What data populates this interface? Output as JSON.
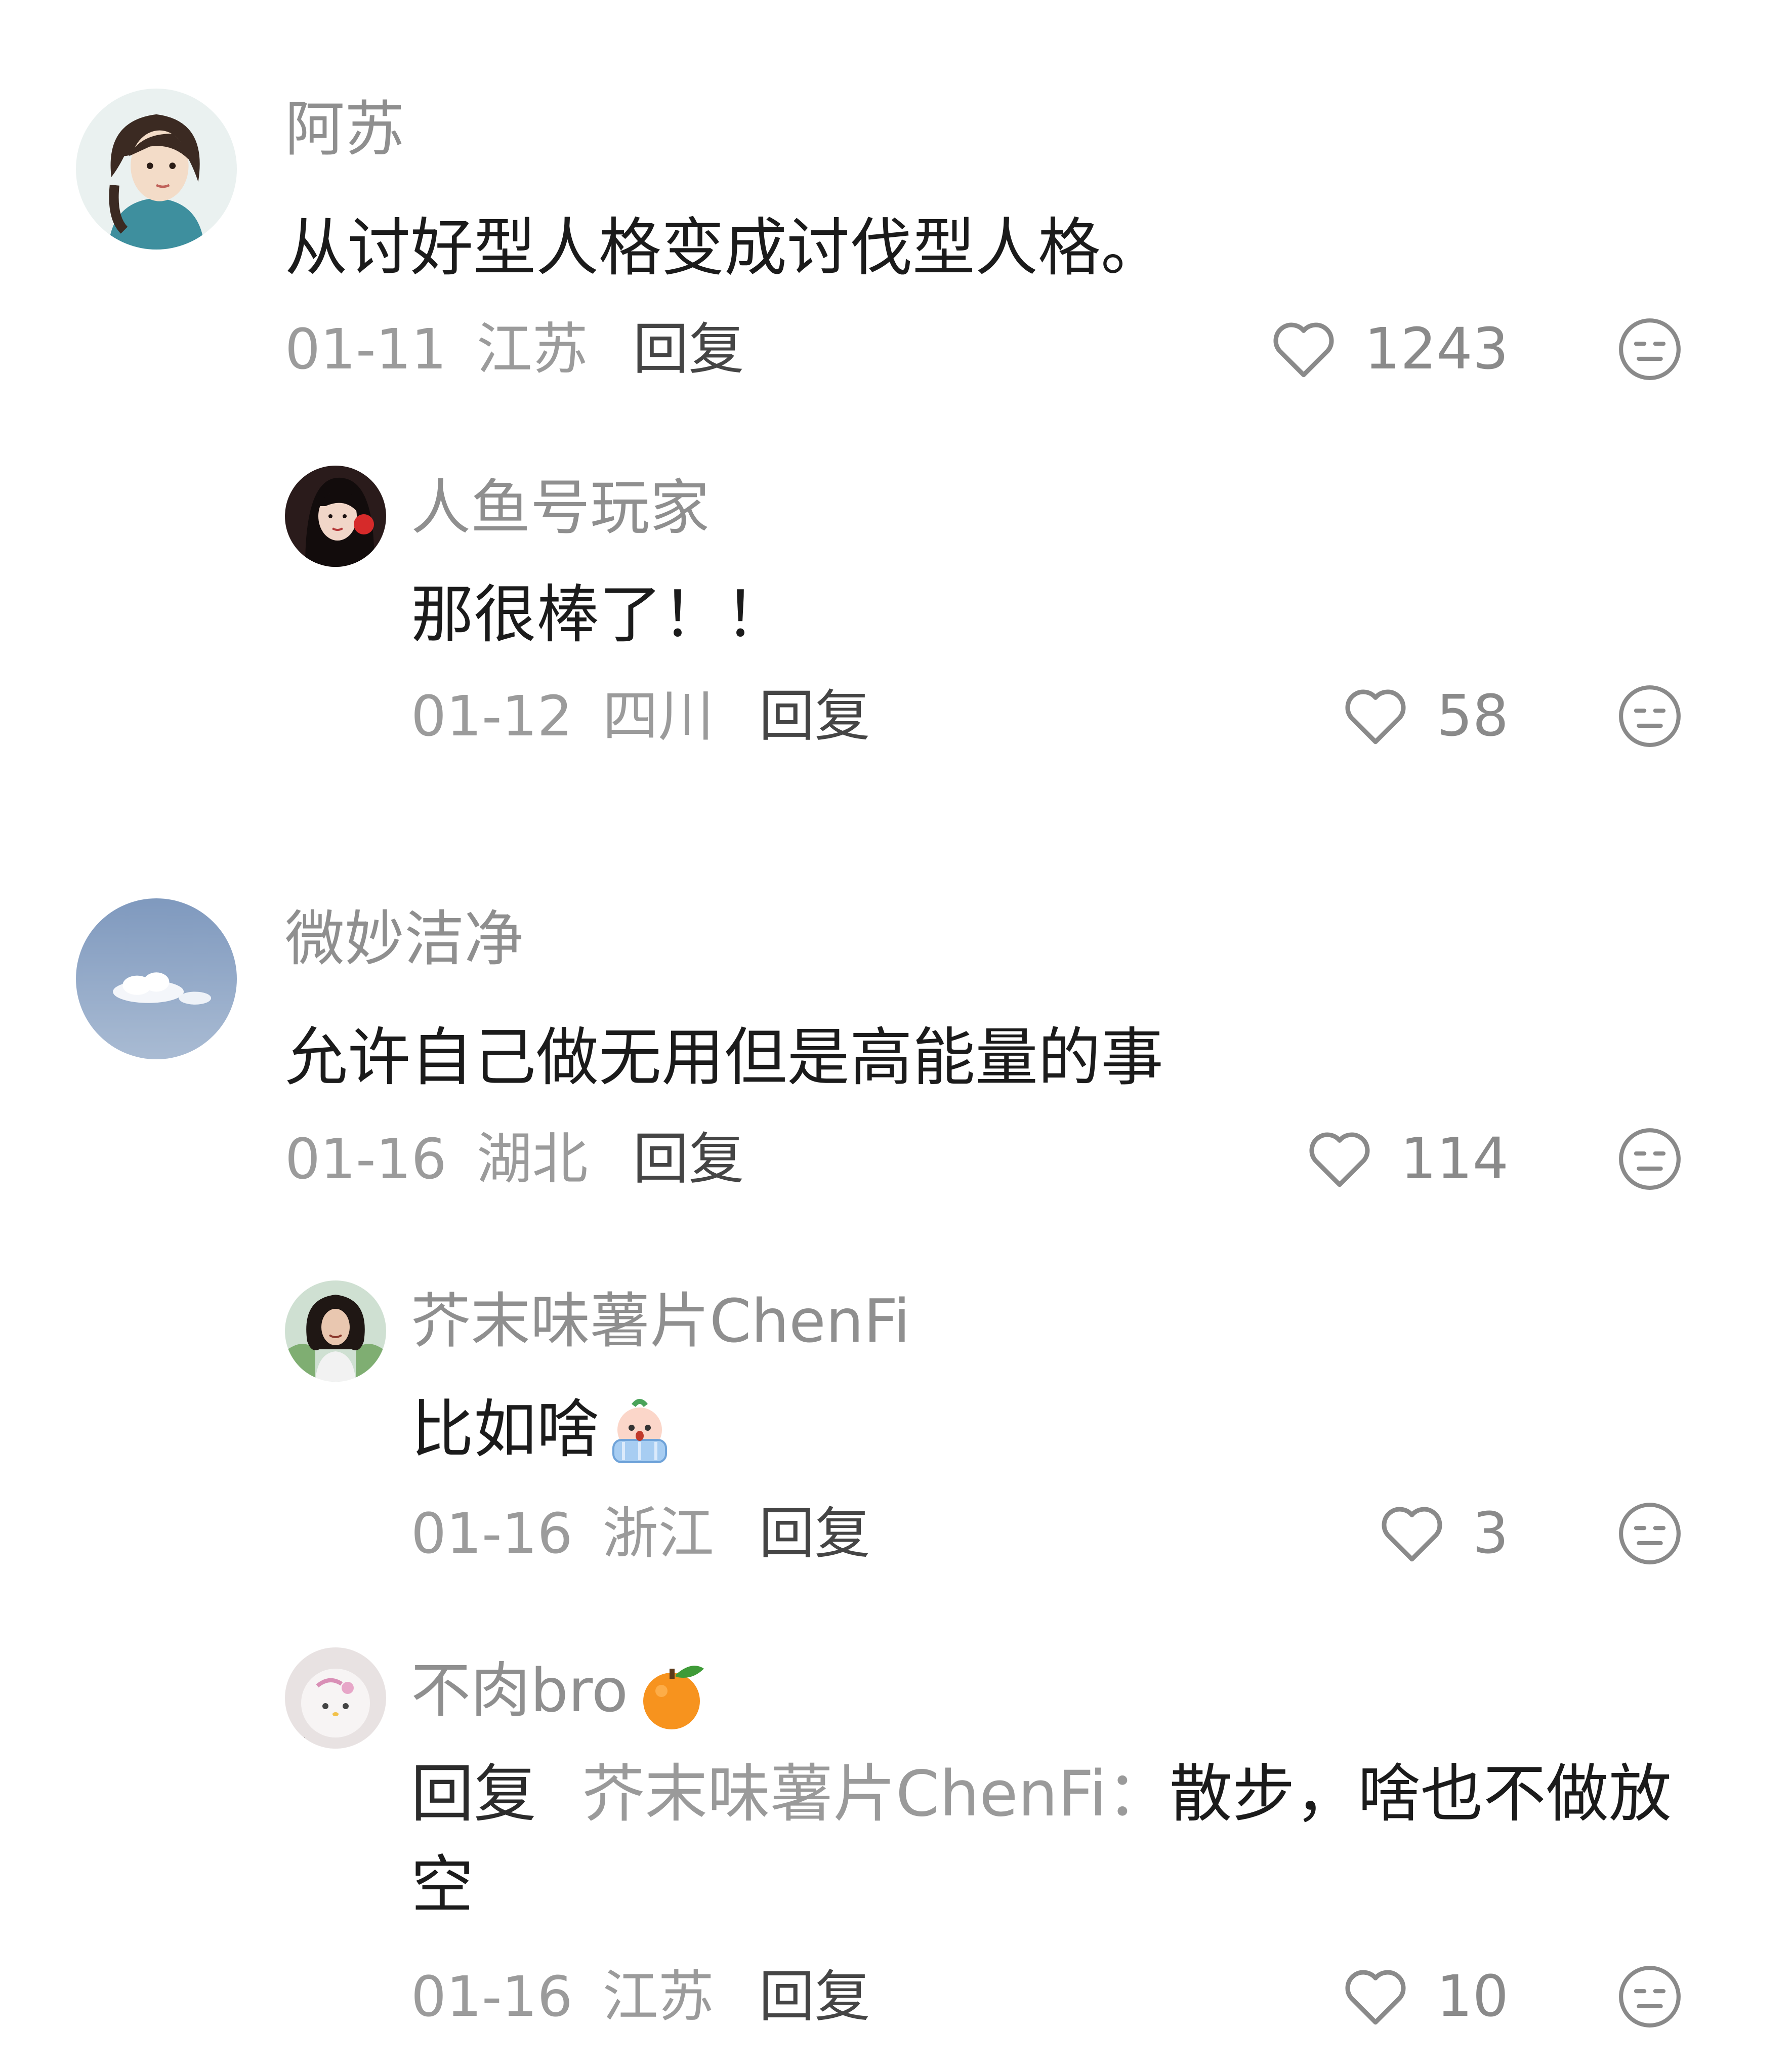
{
  "colors": {
    "name": "#8f8f8f",
    "text": "#1b1b1b",
    "meta": "#9b9b9b",
    "reply": "#454545"
  },
  "comments": [
    {
      "name": "阿苏",
      "text": "从讨好型人格变成讨伐型人格。",
      "date": "01-11",
      "location": "江苏",
      "reply_label": "回复",
      "likes": "1243",
      "replies": [
        {
          "name": "人鱼号玩家",
          "text": "那很棒了！！",
          "date": "01-12",
          "location": "四川",
          "reply_label": "回复",
          "likes": "58"
        }
      ]
    },
    {
      "name": "微妙洁净",
      "text": "允许自己做无用但是高能量的事",
      "date": "01-16",
      "location": "湖北",
      "reply_label": "回复",
      "likes": "114",
      "replies": [
        {
          "name": "芥末味薯片ChenFi",
          "text": "比如啥",
          "emoji": "crying-face-emoji",
          "date": "01-16",
          "location": "浙江",
          "reply_label": "回复",
          "likes": "3"
        },
        {
          "name": "不肉bro",
          "name_emoji": "tangerine-emoji",
          "reply_prefix": "回复",
          "reply_target": "芥末味薯片ChenFi：",
          "text": "散步，啥也不做放空",
          "date": "01-16",
          "location": "江苏",
          "reply_label": "回复",
          "likes": "10"
        }
      ]
    }
  ]
}
